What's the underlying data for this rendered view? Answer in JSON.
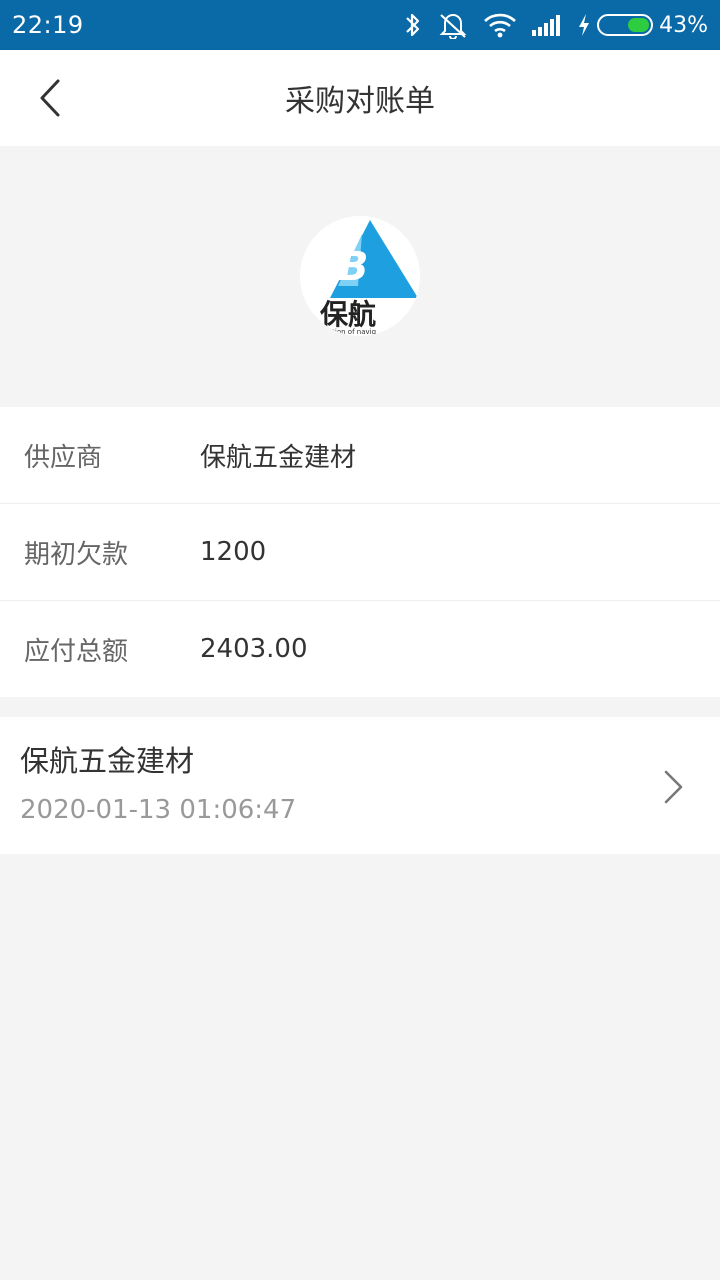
{
  "status_bar": {
    "time": "22:19",
    "battery_percent": "43%",
    "battery_level": 0.43,
    "icons": [
      "bluetooth-icon",
      "mute-icon",
      "wifi-icon",
      "signal-icon",
      "charging-icon",
      "battery-icon"
    ]
  },
  "header": {
    "title": "采购对账单",
    "back_icon": "chevron-left-icon"
  },
  "logo": {
    "text": "保航",
    "tagline": "ection of navig"
  },
  "info": {
    "rows": [
      {
        "label": "供应商",
        "value": "保航五金建材"
      },
      {
        "label": "期初欠款",
        "value": "1200"
      },
      {
        "label": "应付总额",
        "value": "2403.00"
      }
    ]
  },
  "records": [
    {
      "title": "保航五金建材",
      "time": "2020-01-13 01:06:47"
    }
  ],
  "colors": {
    "status_bar_bg": "#0a6aa8",
    "page_bg": "#f4f4f4",
    "battery_fill": "#2ecc40",
    "logo_blue": "#1e9fe0"
  }
}
